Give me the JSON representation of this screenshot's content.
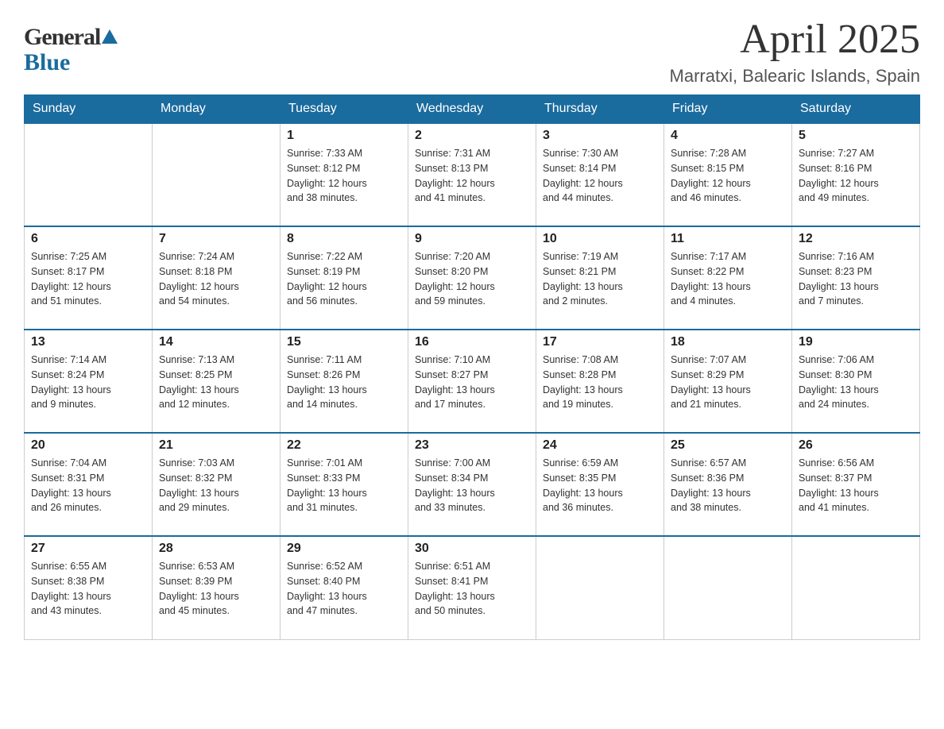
{
  "header": {
    "logo_general": "General",
    "logo_blue": "Blue",
    "main_title": "April 2025",
    "subtitle": "Marratxi, Balearic Islands, Spain"
  },
  "calendar": {
    "days_of_week": [
      "Sunday",
      "Monday",
      "Tuesday",
      "Wednesday",
      "Thursday",
      "Friday",
      "Saturday"
    ],
    "weeks": [
      [
        {
          "day": "",
          "info": ""
        },
        {
          "day": "",
          "info": ""
        },
        {
          "day": "1",
          "info": "Sunrise: 7:33 AM\nSunset: 8:12 PM\nDaylight: 12 hours\nand 38 minutes."
        },
        {
          "day": "2",
          "info": "Sunrise: 7:31 AM\nSunset: 8:13 PM\nDaylight: 12 hours\nand 41 minutes."
        },
        {
          "day": "3",
          "info": "Sunrise: 7:30 AM\nSunset: 8:14 PM\nDaylight: 12 hours\nand 44 minutes."
        },
        {
          "day": "4",
          "info": "Sunrise: 7:28 AM\nSunset: 8:15 PM\nDaylight: 12 hours\nand 46 minutes."
        },
        {
          "day": "5",
          "info": "Sunrise: 7:27 AM\nSunset: 8:16 PM\nDaylight: 12 hours\nand 49 minutes."
        }
      ],
      [
        {
          "day": "6",
          "info": "Sunrise: 7:25 AM\nSunset: 8:17 PM\nDaylight: 12 hours\nand 51 minutes."
        },
        {
          "day": "7",
          "info": "Sunrise: 7:24 AM\nSunset: 8:18 PM\nDaylight: 12 hours\nand 54 minutes."
        },
        {
          "day": "8",
          "info": "Sunrise: 7:22 AM\nSunset: 8:19 PM\nDaylight: 12 hours\nand 56 minutes."
        },
        {
          "day": "9",
          "info": "Sunrise: 7:20 AM\nSunset: 8:20 PM\nDaylight: 12 hours\nand 59 minutes."
        },
        {
          "day": "10",
          "info": "Sunrise: 7:19 AM\nSunset: 8:21 PM\nDaylight: 13 hours\nand 2 minutes."
        },
        {
          "day": "11",
          "info": "Sunrise: 7:17 AM\nSunset: 8:22 PM\nDaylight: 13 hours\nand 4 minutes."
        },
        {
          "day": "12",
          "info": "Sunrise: 7:16 AM\nSunset: 8:23 PM\nDaylight: 13 hours\nand 7 minutes."
        }
      ],
      [
        {
          "day": "13",
          "info": "Sunrise: 7:14 AM\nSunset: 8:24 PM\nDaylight: 13 hours\nand 9 minutes."
        },
        {
          "day": "14",
          "info": "Sunrise: 7:13 AM\nSunset: 8:25 PM\nDaylight: 13 hours\nand 12 minutes."
        },
        {
          "day": "15",
          "info": "Sunrise: 7:11 AM\nSunset: 8:26 PM\nDaylight: 13 hours\nand 14 minutes."
        },
        {
          "day": "16",
          "info": "Sunrise: 7:10 AM\nSunset: 8:27 PM\nDaylight: 13 hours\nand 17 minutes."
        },
        {
          "day": "17",
          "info": "Sunrise: 7:08 AM\nSunset: 8:28 PM\nDaylight: 13 hours\nand 19 minutes."
        },
        {
          "day": "18",
          "info": "Sunrise: 7:07 AM\nSunset: 8:29 PM\nDaylight: 13 hours\nand 21 minutes."
        },
        {
          "day": "19",
          "info": "Sunrise: 7:06 AM\nSunset: 8:30 PM\nDaylight: 13 hours\nand 24 minutes."
        }
      ],
      [
        {
          "day": "20",
          "info": "Sunrise: 7:04 AM\nSunset: 8:31 PM\nDaylight: 13 hours\nand 26 minutes."
        },
        {
          "day": "21",
          "info": "Sunrise: 7:03 AM\nSunset: 8:32 PM\nDaylight: 13 hours\nand 29 minutes."
        },
        {
          "day": "22",
          "info": "Sunrise: 7:01 AM\nSunset: 8:33 PM\nDaylight: 13 hours\nand 31 minutes."
        },
        {
          "day": "23",
          "info": "Sunrise: 7:00 AM\nSunset: 8:34 PM\nDaylight: 13 hours\nand 33 minutes."
        },
        {
          "day": "24",
          "info": "Sunrise: 6:59 AM\nSunset: 8:35 PM\nDaylight: 13 hours\nand 36 minutes."
        },
        {
          "day": "25",
          "info": "Sunrise: 6:57 AM\nSunset: 8:36 PM\nDaylight: 13 hours\nand 38 minutes."
        },
        {
          "day": "26",
          "info": "Sunrise: 6:56 AM\nSunset: 8:37 PM\nDaylight: 13 hours\nand 41 minutes."
        }
      ],
      [
        {
          "day": "27",
          "info": "Sunrise: 6:55 AM\nSunset: 8:38 PM\nDaylight: 13 hours\nand 43 minutes."
        },
        {
          "day": "28",
          "info": "Sunrise: 6:53 AM\nSunset: 8:39 PM\nDaylight: 13 hours\nand 45 minutes."
        },
        {
          "day": "29",
          "info": "Sunrise: 6:52 AM\nSunset: 8:40 PM\nDaylight: 13 hours\nand 47 minutes."
        },
        {
          "day": "30",
          "info": "Sunrise: 6:51 AM\nSunset: 8:41 PM\nDaylight: 13 hours\nand 50 minutes."
        },
        {
          "day": "",
          "info": ""
        },
        {
          "day": "",
          "info": ""
        },
        {
          "day": "",
          "info": ""
        }
      ]
    ]
  }
}
